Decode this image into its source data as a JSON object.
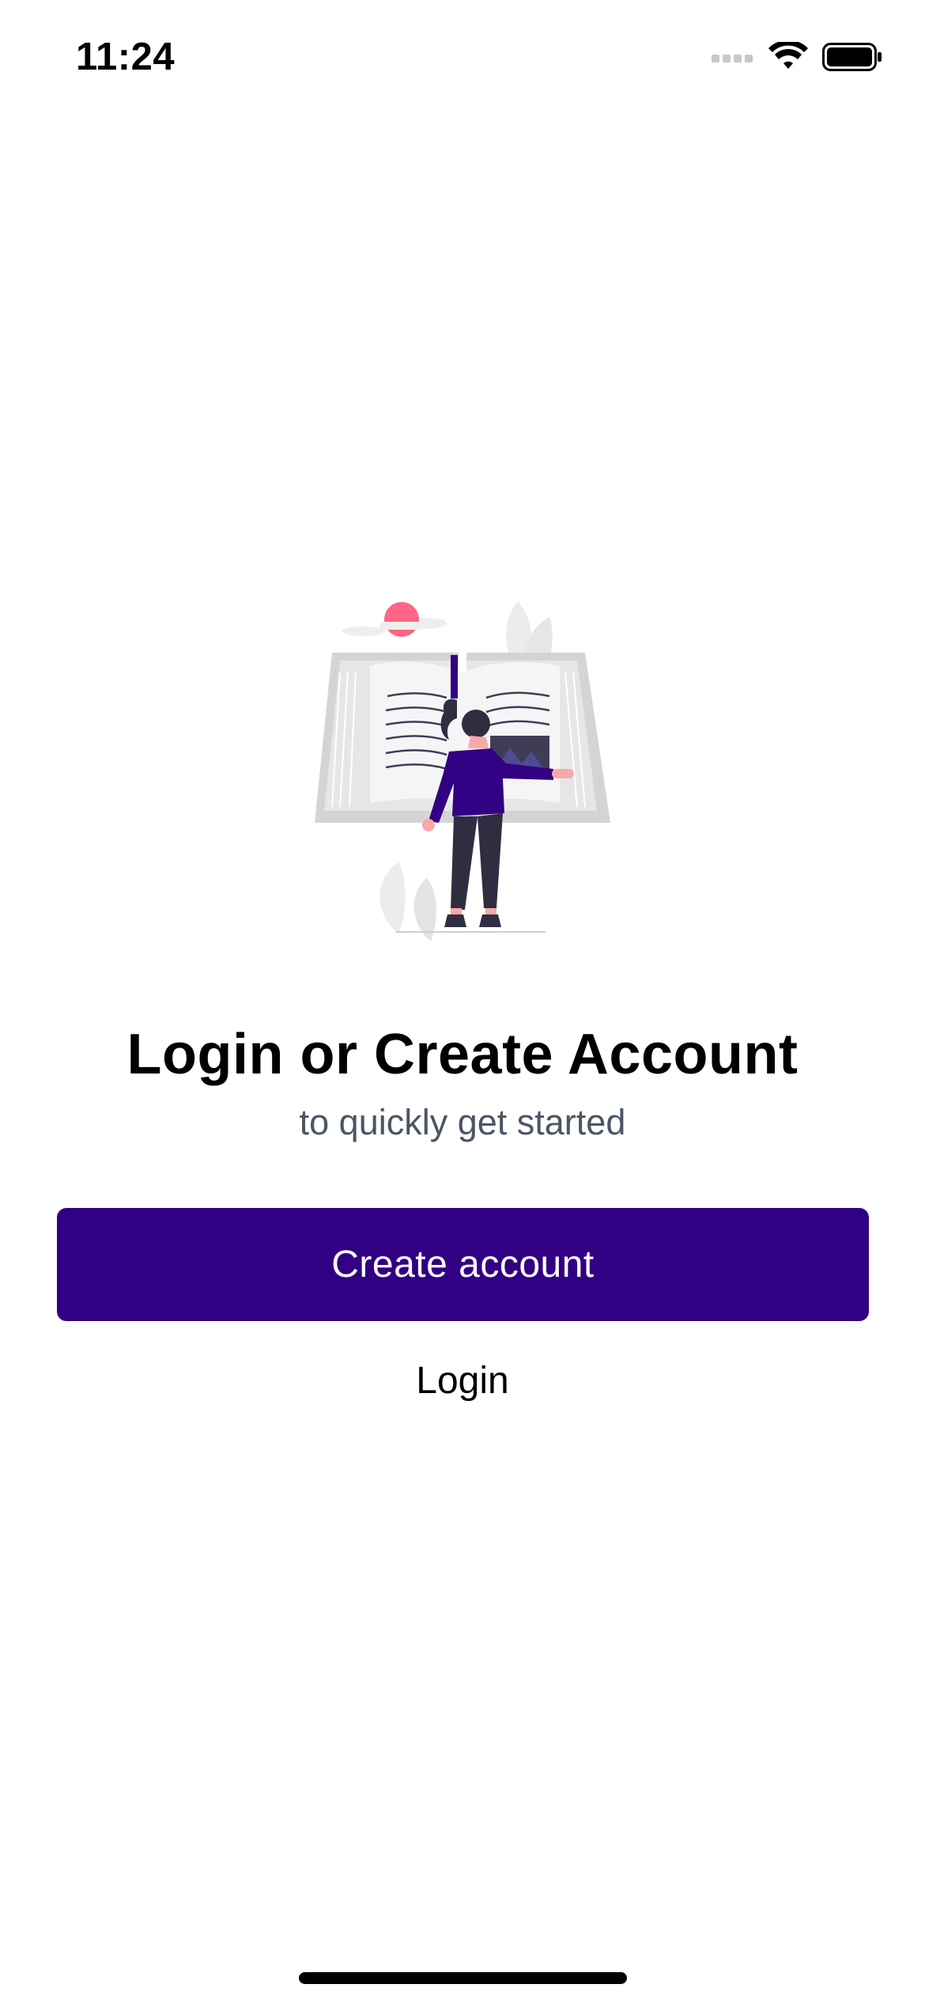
{
  "status_bar": {
    "time": "11:24",
    "icons": [
      "signal-icon",
      "wifi-icon",
      "battery-icon"
    ]
  },
  "illustration": {
    "icon": "reading-woman-book-illustration"
  },
  "content": {
    "title": "Login or Create Account",
    "subtitle": "to quickly get started"
  },
  "actions": {
    "create_account_label": "Create account",
    "login_label": "Login"
  },
  "colors": {
    "primary": "#320082",
    "subtitle": "#4b5565",
    "accent_pink": "#ff6584"
  }
}
